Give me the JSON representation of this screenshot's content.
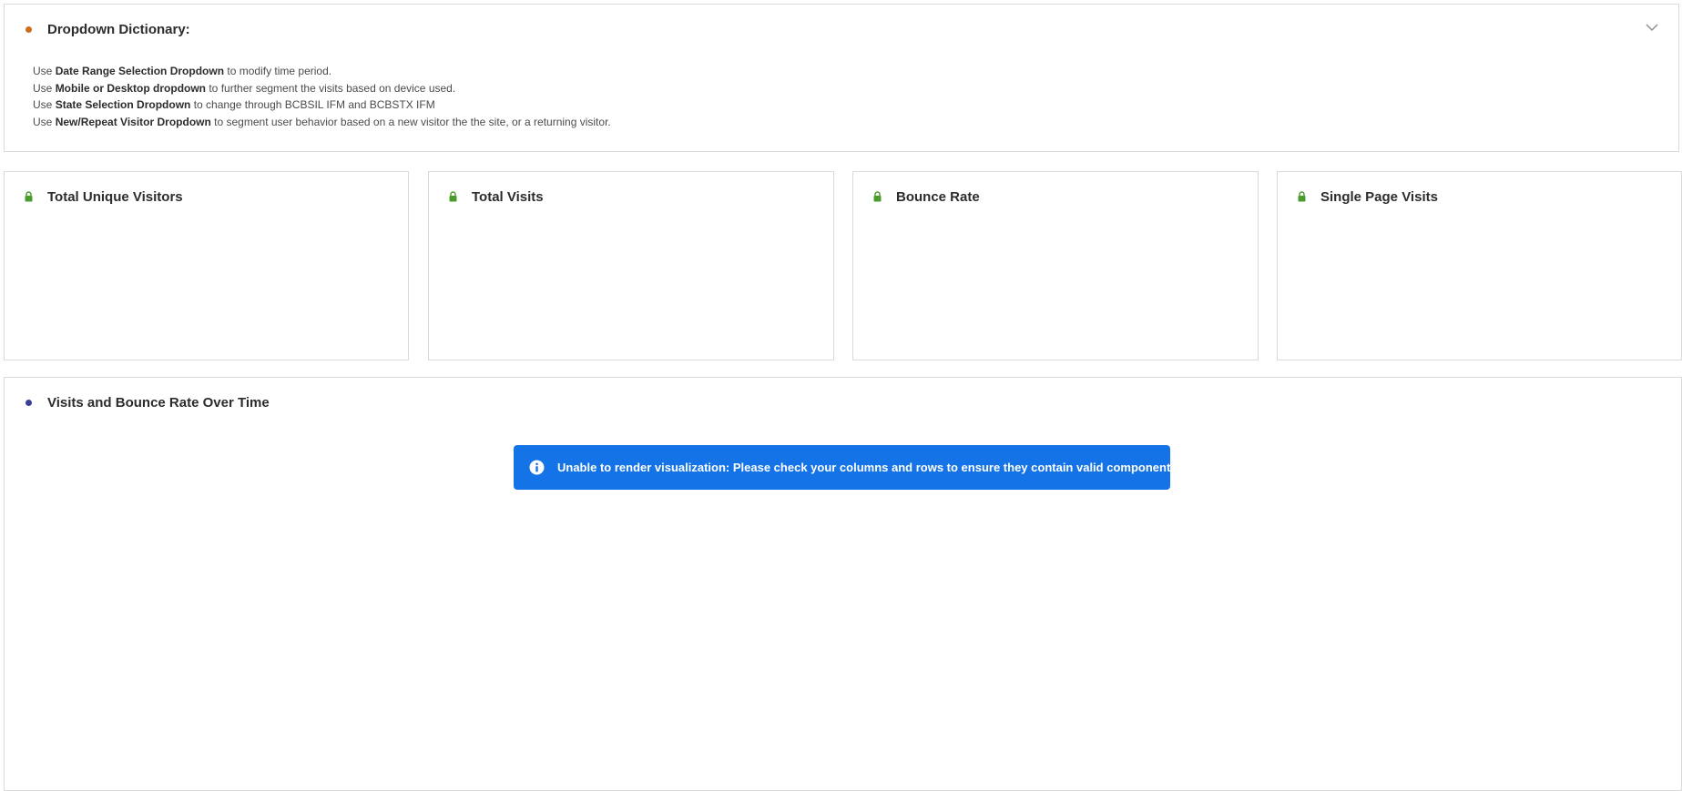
{
  "dictionary": {
    "title": "Dropdown Dictionary:",
    "dot_color": "#cc6d1b",
    "lines": [
      {
        "prefix": "Use ",
        "bold": "Date Range Selection Dropdown",
        "suffix": " to modify time period."
      },
      {
        "prefix": "Use ",
        "bold": "Mobile or Desktop dropdown",
        "suffix": " to further segment the visits based on device used."
      },
      {
        "prefix": "Use ",
        "bold": "State Selection Dropdown",
        "suffix": " to change through BCBSIL IFM and BCBSTX IFM"
      },
      {
        "prefix": "Use ",
        "bold": "New/Repeat Visitor Dropdown",
        "suffix": " to segment user behavior based on a new visitor the the site, or a returning visitor."
      }
    ],
    "collapse_icon": "chevron-down-icon"
  },
  "metrics": [
    {
      "title": "Total Unique Visitors",
      "icon": "lock-icon"
    },
    {
      "title": "Total Visits",
      "icon": "lock-icon"
    },
    {
      "title": "Bounce Rate",
      "icon": "lock-icon"
    },
    {
      "title": "Single Page Visits",
      "icon": "lock-icon"
    }
  ],
  "chart_panel": {
    "title": "Visits and Bounce Rate Over Time",
    "dot_color": "#3b3f9c"
  },
  "alert": {
    "icon": "info-icon",
    "message": "Unable to render visualization: Please check your columns and rows to ensure they contain valid components.",
    "color": "#1473e6"
  },
  "lock_color": "#4b9c2d"
}
